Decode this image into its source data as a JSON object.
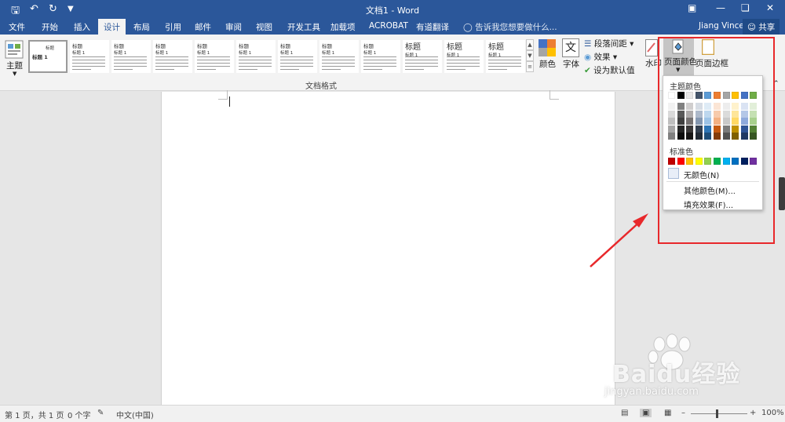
{
  "window": {
    "title": "文档1 - Word"
  },
  "tabs": [
    {
      "label": "文件"
    },
    {
      "label": "开始"
    },
    {
      "label": "插入"
    },
    {
      "label": "设计"
    },
    {
      "label": "布局"
    },
    {
      "label": "引用"
    },
    {
      "label": "邮件"
    },
    {
      "label": "审阅"
    },
    {
      "label": "视图"
    },
    {
      "label": "开发工具"
    },
    {
      "label": "加载项"
    },
    {
      "label": "ACROBAT"
    },
    {
      "label": "有道翻译"
    }
  ],
  "tell_me": "告诉我您想要做什么...",
  "user": {
    "name": "Jiang Vince",
    "share": "共享"
  },
  "ribbon": {
    "theme_label": "主题",
    "gallery": {
      "group_label": "文档格式",
      "first_title": "标题",
      "first_heading": "标题 1",
      "item_title": "标题",
      "item_heading": "标题 1"
    },
    "colors_label": "颜色",
    "fonts_label": "字体",
    "fonts_glyph": "文",
    "paragraph_spacing": "段落间距",
    "effects": "效果",
    "set_default": "设为默认值",
    "watermark": "水印",
    "page_color": "页面颜色",
    "page_borders": "页面边框"
  },
  "color_menu": {
    "theme_colors_title": "主题颜色",
    "standard_colors_title": "标准色",
    "no_color": "无颜色(N)",
    "more_colors": "其他颜色(M)...",
    "fill_effects": "填充效果(F)...",
    "theme_top": [
      "#ffffff",
      "#000000",
      "#e7e6e6",
      "#44546a",
      "#5b9bd5",
      "#ed7d31",
      "#a5a5a5",
      "#ffc000",
      "#4472c4",
      "#70ad47"
    ],
    "theme_shades": [
      [
        "#f2f2f2",
        "#d9d9d9",
        "#bfbfbf",
        "#a6a6a6",
        "#808080"
      ],
      [
        "#808080",
        "#595959",
        "#404040",
        "#262626",
        "#0d0d0d"
      ],
      [
        "#d0cece",
        "#aeabab",
        "#757171",
        "#3a3838",
        "#171616"
      ],
      [
        "#d6dce4",
        "#adb9ca",
        "#8497b0",
        "#333f4f",
        "#222a35"
      ],
      [
        "#deebf6",
        "#bdd7ee",
        "#9dc3e6",
        "#2e75b5",
        "#1f4e79"
      ],
      [
        "#fbe5d5",
        "#f7cbac",
        "#f4b183",
        "#c55a11",
        "#833c0b"
      ],
      [
        "#ededed",
        "#dbdbdb",
        "#c9c9c9",
        "#7b7b7b",
        "#525252"
      ],
      [
        "#fff2cc",
        "#fee599",
        "#ffd965",
        "#bf9000",
        "#7f6000"
      ],
      [
        "#dae3f3",
        "#b4c7e7",
        "#8faadc",
        "#2f5496",
        "#1f3864"
      ],
      [
        "#e2efd9",
        "#c5e0b3",
        "#a8d08d",
        "#538135",
        "#375623"
      ]
    ],
    "standard": [
      "#c00000",
      "#ff0000",
      "#ffc000",
      "#ffff00",
      "#92d050",
      "#00b050",
      "#00b0f0",
      "#0070c0",
      "#002060",
      "#7030a0"
    ]
  },
  "status": {
    "page": "第 1 页，共 1 页",
    "words": "0 个字",
    "language": "中文(中国)",
    "zoom": "100%"
  },
  "watermark": {
    "brand": "Baidu经验",
    "url": "jingyan.baidu.com"
  }
}
